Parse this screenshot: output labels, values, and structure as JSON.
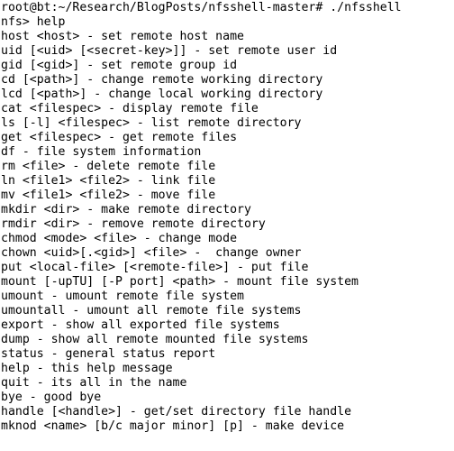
{
  "terminal": {
    "app_name": "nfsshell",
    "background_color": "#ffffff",
    "foreground_color": "#000000",
    "prompt_line": "root@bt:~/Research/BlogPosts/nfsshell-master# ./nfsshell",
    "command_prompt_line": "nfs> help",
    "lines": [
      "root@bt:~/Research/BlogPosts/nfsshell-master# ./nfsshell",
      "nfs> help",
      "host <host> - set remote host name",
      "uid [<uid> [<secret-key>]] - set remote user id",
      "gid [<gid>] - set remote group id",
      "cd [<path>] - change remote working directory",
      "lcd [<path>] - change local working directory",
      "cat <filespec> - display remote file",
      "ls [-l] <filespec> - list remote directory",
      "get <filespec> - get remote files",
      "df - file system information",
      "rm <file> - delete remote file",
      "ln <file1> <file2> - link file",
      "mv <file1> <file2> - move file",
      "mkdir <dir> - make remote directory",
      "rmdir <dir> - remove remote directory",
      "chmod <mode> <file> - change mode",
      "chown <uid>[.<gid>] <file> -  change owner",
      "put <local-file> [<remote-file>] - put file",
      "mount [-upTU] [-P port] <path> - mount file system",
      "umount - umount remote file system",
      "umountall - umount all remote file systems",
      "export - show all exported file systems",
      "dump - show all remote mounted file systems",
      "status - general status report",
      "help - this help message",
      "quit - its all in the name",
      "bye - good bye",
      "handle [<handle>] - get/set directory file handle",
      "mknod <name> [b/c major minor] [p] - make device"
    ]
  }
}
